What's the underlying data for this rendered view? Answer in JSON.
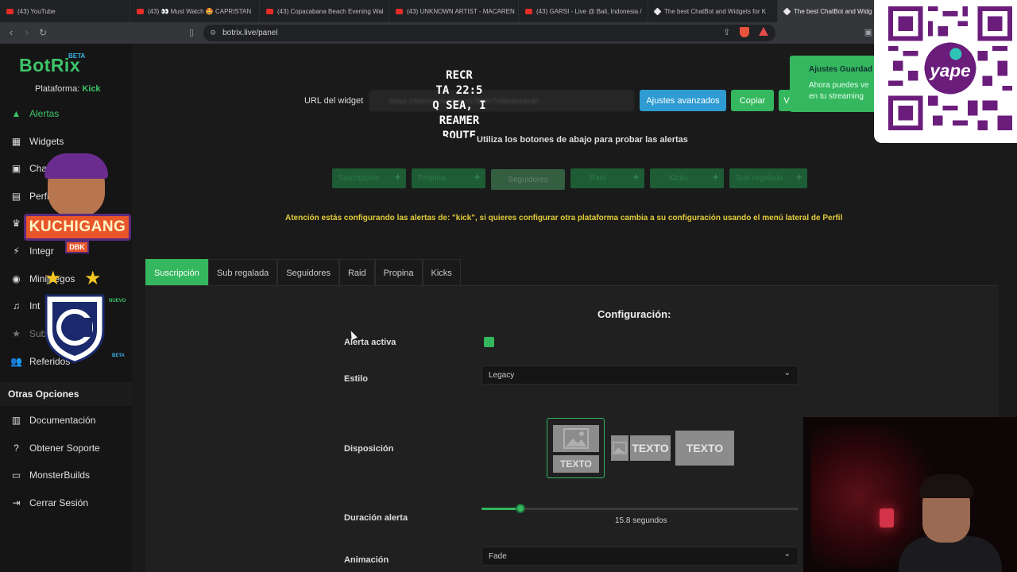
{
  "browser": {
    "tabs": [
      {
        "label": "(43) YouTube",
        "icon": "youtube-icon"
      },
      {
        "label": "(43) 👀 Must Watch 🤩 CAPRISTAN",
        "icon": "youtube-icon"
      },
      {
        "label": "(43) Copacabana Beach Evening Wal",
        "icon": "youtube-icon"
      },
      {
        "label": "(43) UNKNOWN ARTIST - MACAREN",
        "icon": "youtube-icon"
      },
      {
        "label": "(43) GARSI - Live @ Bali, Indonesia /",
        "icon": "youtube-icon"
      },
      {
        "label": "The best ChatBot and Widgets for K",
        "icon": "botrix-icon"
      },
      {
        "label": "The best ChatBot and Widg",
        "icon": "botrix-icon",
        "active": true
      }
    ],
    "url": "botrix.live/panel"
  },
  "sidebar": {
    "logo": "BotRix",
    "logo_badge": "BETA",
    "platform_label": "Plataforma:",
    "platform_value": "Kick",
    "items": [
      {
        "label": "Alertas",
        "icon": "warning-icon"
      },
      {
        "label": "Widgets",
        "icon": "grid-icon"
      },
      {
        "label": "Chat",
        "icon": "robot-icon"
      },
      {
        "label": "Perfil",
        "icon": "id-card-icon"
      },
      {
        "label": "",
        "icon": "trophy-icon"
      },
      {
        "label": "Integr",
        "icon": "plug-icon"
      },
      {
        "label": "Minijuegos",
        "icon": "gamepad-icon"
      },
      {
        "label": "Int",
        "icon": "music-icon"
      },
      {
        "label": "Sub",
        "icon": "star-icon"
      },
      {
        "label": "Referidos",
        "icon": "users-icon"
      }
    ],
    "badge_nuevo": "NUEVO",
    "badge_beta": "BETA",
    "other_title": "Otras Opciones",
    "other_items": [
      {
        "label": "Documentación",
        "icon": "book-icon"
      },
      {
        "label": "Obtener Soporte",
        "icon": "question-icon"
      },
      {
        "label": "MonsterBuilds",
        "icon": "laptop-icon"
      },
      {
        "label": "Cerrar Sesión",
        "icon": "logout-icon"
      }
    ]
  },
  "overlay": {
    "kuchi_text": "KUCHIGANG",
    "kuchi_sub": "DBK",
    "recre_lines": [
      "RECR",
      "TA 22:5",
      "Q SEA, I",
      "REAMER",
      "ROUTE"
    ]
  },
  "widget": {
    "label": "URL del widget",
    "value": "https://botrix.live/alerts?bid=7d9b3eeae8f...",
    "advanced_button": "Ajustes avanzados",
    "copy_button": "Copiar",
    "third_button": "V"
  },
  "toast": {
    "title": "Ajustes Guardad",
    "line1": "Ahora puedes ve",
    "line2": "en tu streaming"
  },
  "test": {
    "hint": "Utiliza los botones de abajo para probar las alertas",
    "buttons": [
      "Suscripción",
      "Propina",
      "Seguidores",
      "Raid",
      "Kicks",
      "Sub regalada"
    ]
  },
  "warning": "Atención estás configurando las alertas de: \"kick\", si quieres configurar otra plataforma cambia a su configuración usando el menú lateral de Perfil",
  "tabs": {
    "items": [
      "Suscripción",
      "Sub regalada",
      "Seguidores",
      "Raid",
      "Propina",
      "Kicks"
    ],
    "active_index": 0
  },
  "config": {
    "title": "Configuración:",
    "alert_active_label": "Alerta activa",
    "alert_active": true,
    "style_label": "Estilo",
    "style_value": "Legacy",
    "layout_label": "Disposición",
    "layout_options": [
      "TEXTO",
      "TEXTO",
      "TEXTO"
    ],
    "layout_selected": 0,
    "duration_label": "Duración alerta",
    "duration_fraction": 0.122,
    "duration_text": "15.8 segundos",
    "animation_label": "Animación",
    "animation_value": "Fade"
  },
  "colors": {
    "accent_green": "#34b75e",
    "accent_blue": "#2e9bd2",
    "warning_yellow": "#e3cc3b"
  }
}
